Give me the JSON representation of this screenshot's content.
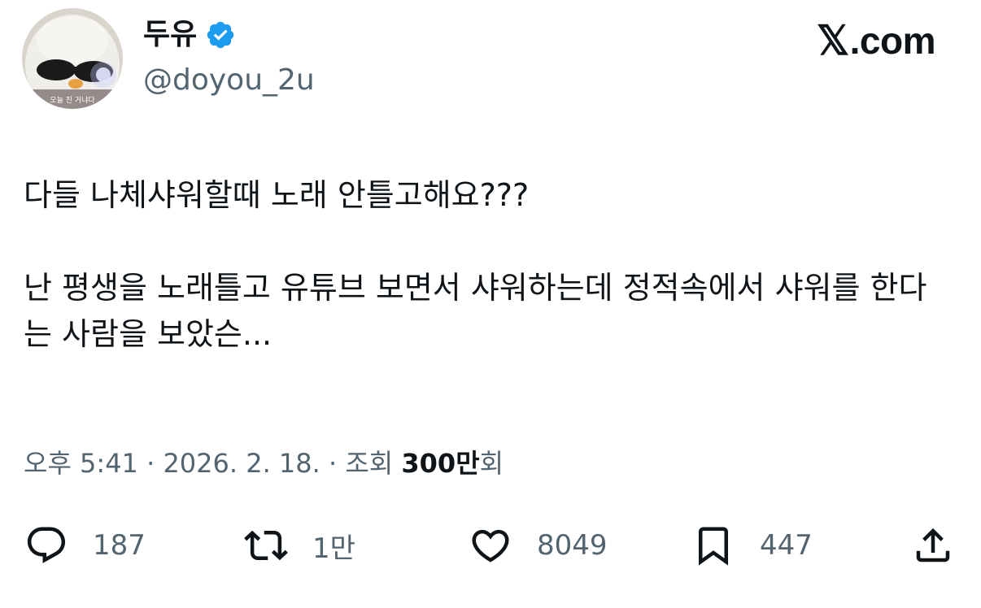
{
  "author": {
    "display_name": "두유",
    "handle": "@doyou_2u",
    "verified": true,
    "avatar_caption": "오늘 진 거냐다"
  },
  "brand": {
    "x_mark": "𝕏",
    "domain": ".com"
  },
  "tweet": {
    "paragraphs": [
      "다들 나체샤워할때 노래 안틀고해요???",
      "난 평생을 노래틀고 유튜브 보면서 샤워하는데 정적속에서 샤워를 한다는 사람을 보았슨..."
    ]
  },
  "meta": {
    "time": "오후 5:41",
    "sep1": " · ",
    "date": "2026. 2. 18.",
    "sep2": " · ",
    "views_label": "조회 ",
    "views_count": "300만",
    "views_suffix": "회"
  },
  "actions": {
    "replies": "187",
    "retweets": "1만",
    "likes": "8049",
    "bookmarks": "447"
  },
  "colors": {
    "text": "#0f1419",
    "secondary": "#536471",
    "verified": "#1d9bf0"
  }
}
